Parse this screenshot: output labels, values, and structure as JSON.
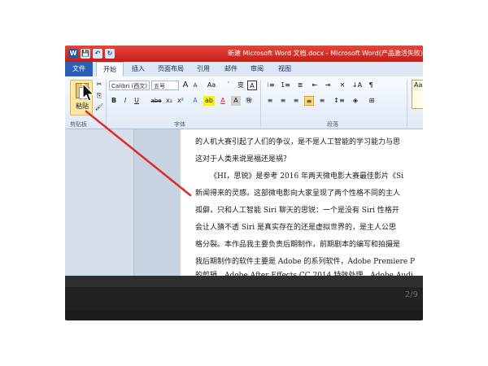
{
  "window": {
    "title": "新建 Microsoft Word 文档.docx - Microsoft Word(产品激活失败)"
  },
  "quick_access": {
    "save_label": "💾",
    "undo_label": "↶",
    "redo_label": "↻"
  },
  "tabs": [
    "文件",
    "开始",
    "插入",
    "页面布局",
    "引用",
    "邮件",
    "审阅",
    "视图"
  ],
  "ribbon": {
    "paste_label": "粘贴",
    "clipboard_group": "剪贴板",
    "font_group": "字体",
    "paragraph_group": "段落",
    "font_name": "Calibri (西文)",
    "font_size": "五号",
    "grow_font": "A",
    "shrink_font": "A",
    "change_case": "Aa",
    "clear_format": "ﾞ",
    "phonetic": "变",
    "char_border": "A",
    "bold": "B",
    "italic": "I",
    "underline": "U",
    "strike": "abe",
    "subscript": "x₂",
    "superscript": "x²",
    "style_preview": "Aa"
  },
  "document": {
    "lines": [
      "的人机大赛引起了人们的争议，是不是人工智能的学习能力与思",
      "这对于人类来说是福还是祸？",
      "《HI，思锐》是参考 2016 年两天微电影大赛最佳影片《Si",
      "新闻得来的灵感。这部微电影向大家呈现了两个性格不同的主人",
      "孤僻，只和人工智能 Siri 聊天的思锐：一个是没有 Siri 性格开",
      "会让人猜不透 Siri 是真实存在的还是虚拟世界的，是主人公思",
      "格分裂。本作品我主要负责后期制作，前期剧本的编写和拍摄是",
      "我后期制作的软件主要是 Adobe 的系列软件，Adobe Premiere P",
      "的剪辑，Adobe After Effects CC 2014 特效处理，Adobe Audi"
    ]
  },
  "status": {
    "page_count": "2/9"
  }
}
